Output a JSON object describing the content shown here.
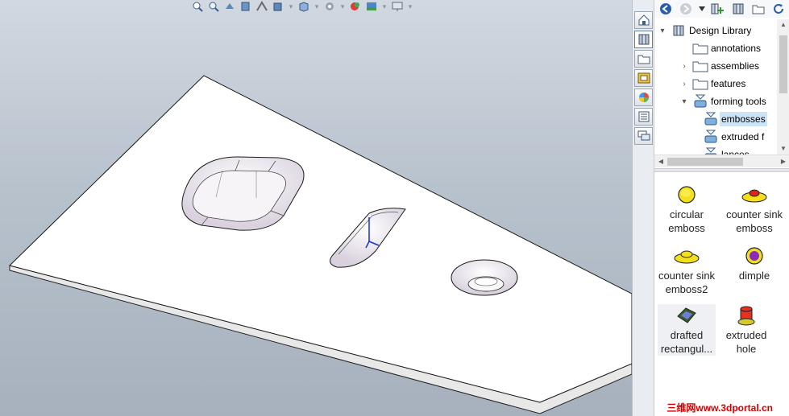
{
  "library_panel": {
    "tree": [
      {
        "label": "Design Library",
        "expander": "▾",
        "icon": "design-library-icon"
      },
      {
        "label": "annotations",
        "expander": "",
        "icon": "folder-icon"
      },
      {
        "label": "assemblies",
        "expander": "›",
        "icon": "folder-icon"
      },
      {
        "label": "features",
        "expander": "›",
        "icon": "folder-icon"
      },
      {
        "label": "forming tools",
        "expander": "▾",
        "icon": "forming-tools-icon"
      },
      {
        "label": "embosses",
        "expander": "",
        "icon": "forming-tools-icon",
        "selected": true
      },
      {
        "label": "extruded f",
        "expander": "",
        "icon": "forming-tools-icon"
      },
      {
        "label": "lances",
        "expander": "",
        "icon": "forming-tools-icon"
      }
    ],
    "items": [
      {
        "label_1": "circular",
        "label_2": "emboss",
        "icon": "circular-emboss-icon"
      },
      {
        "label_1": "counter sink",
        "label_2": "emboss",
        "icon": "counter-sink-emboss-icon"
      },
      {
        "label_1": "counter sink",
        "label_2": "emboss2",
        "icon": "counter-sink-emboss2-icon"
      },
      {
        "label_1": "dimple",
        "label_2": "",
        "icon": "dimple-icon"
      },
      {
        "label_1": "drafted",
        "label_2": "rectangul...",
        "icon": "drafted-rectangular-icon"
      },
      {
        "label_1": "extruded",
        "label_2": "hole",
        "icon": "extruded-hole-icon"
      }
    ]
  },
  "watermark": "三维网www.3dportal.cn",
  "colors": {
    "viewport_top": "#d2d8e0",
    "viewport_bottom": "#a7b1bd",
    "selection": "#cce4f7",
    "watermark": "#d40000"
  }
}
